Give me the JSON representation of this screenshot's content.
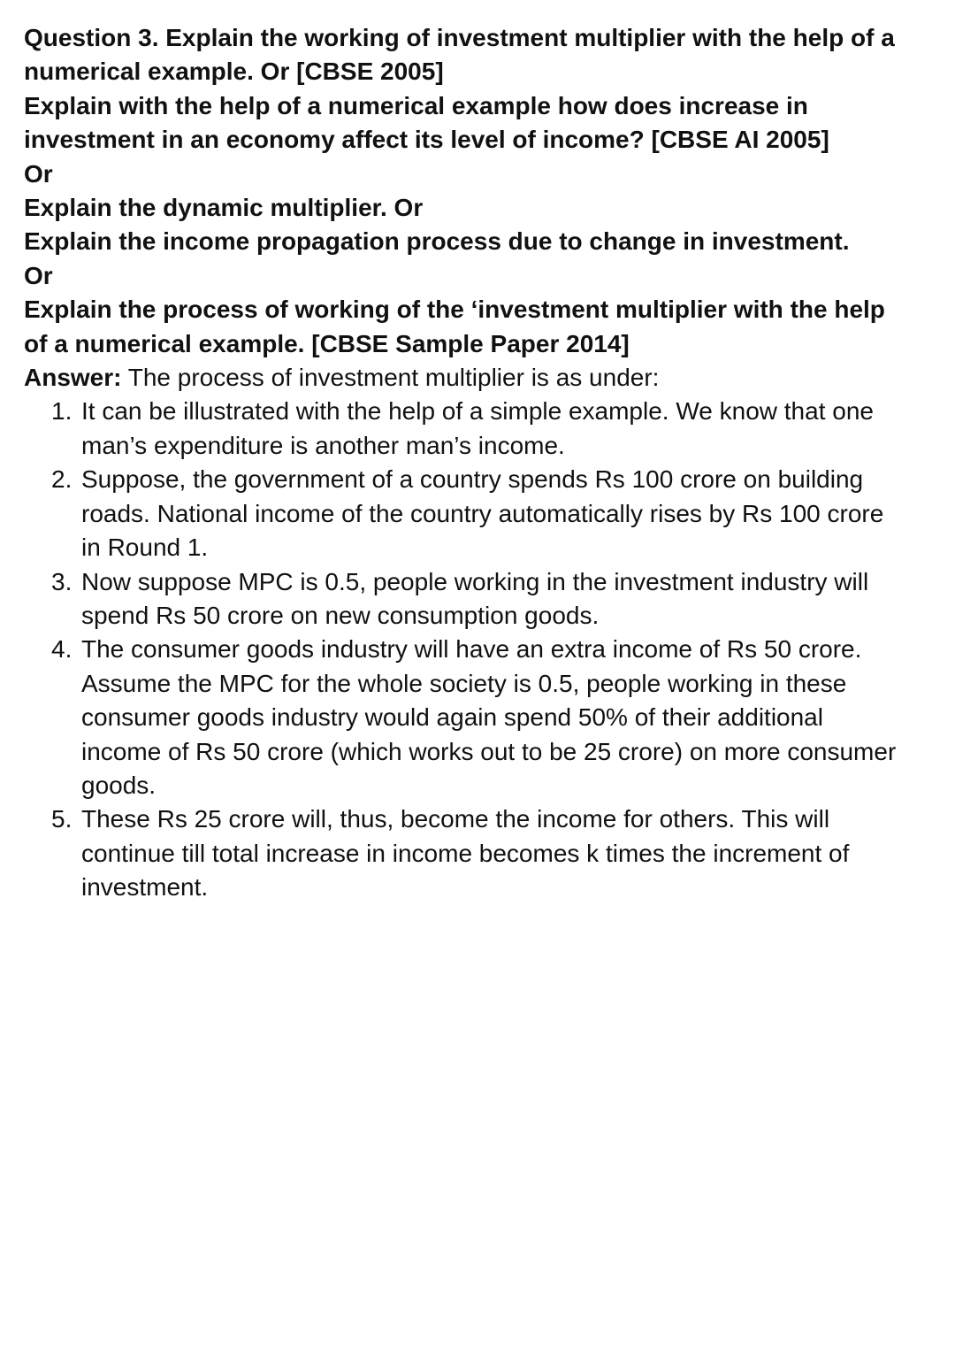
{
  "question": {
    "lines": [
      "Question 3. Explain the working of investment multiplier with the help of a",
      "numerical example. Or [CBSE 2005]",
      "Explain with the help of a numerical example how does increase in",
      "investment in an economy affect its level of income? [CBSE AI 2005]",
      "Or",
      "Explain the dynamic multiplier. Or",
      "Explain the income propagation process due to change in investment.",
      "Or",
      "Explain the process of working of the ‘investment multiplier with the help",
      "of a numerical example. [CBSE Sample Paper 2014]"
    ]
  },
  "answer": {
    "label": "Answer:",
    "intro": " The process of investment multiplier is as under:",
    "points": [
      {
        "number": "1.",
        "lines": [
          " It can be illustrated with the help of a simple example. We know that one",
          "man’s expenditure is another man’s income."
        ]
      },
      {
        "number": "2.",
        "lines": [
          " Suppose, the government of a country spends Rs 100 crore on building",
          "roads. National income of the country automatically rises by Rs 100 crore",
          "in Round 1."
        ]
      },
      {
        "number": "3.",
        "lines": [
          "Now suppose MPC is 0.5, people working in the investment industry will",
          "spend Rs 50 crore on new consumption goods."
        ]
      },
      {
        "number": "4.",
        "lines": [
          "The consumer goods industry will have an extra income of Rs 50 crore.",
          "Assume the MPC for the whole society is 0.5, people working in these",
          "consumer goods industry would again spend 50% of their additional",
          "income of Rs 50 crore (which works out to be 25 crore) on more consumer",
          "goods."
        ]
      },
      {
        "number": "5.",
        "lines": [
          "These Rs 25 crore will, thus, become the income for others. This will",
          "continue till total increase in income becomes k times the increment of",
          "investment."
        ]
      }
    ]
  }
}
